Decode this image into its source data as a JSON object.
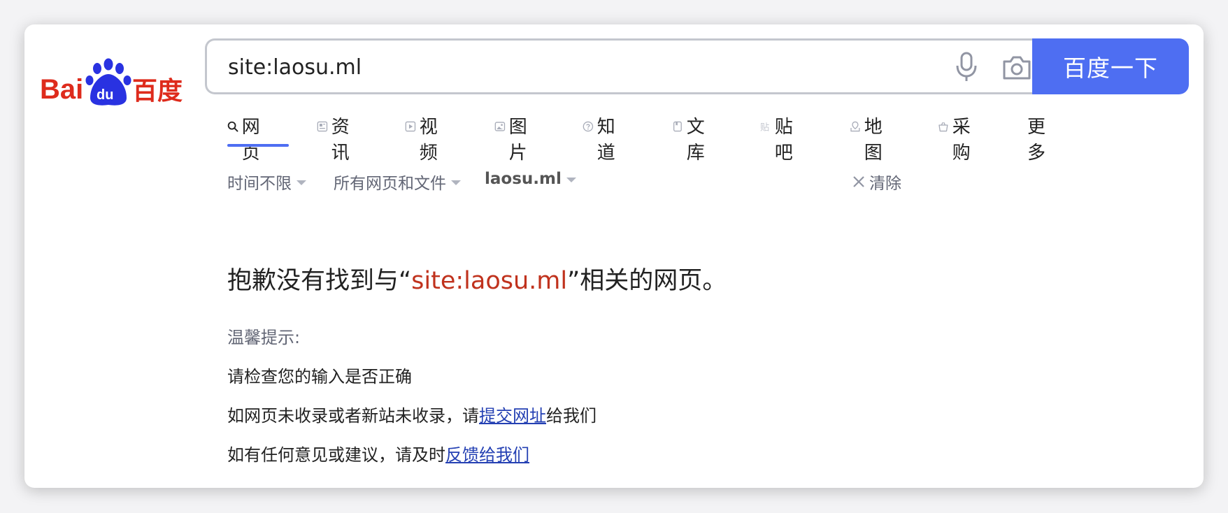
{
  "logo": {
    "brand_text_left": "Bai",
    "brand_text_paw": "du",
    "brand_text_right": "百度"
  },
  "search": {
    "query": "site:laosu.ml",
    "button_label": "百度一下"
  },
  "tabs": [
    {
      "label": "网页",
      "icon": "search-icon",
      "active": true
    },
    {
      "label": "资讯",
      "icon": "news-icon"
    },
    {
      "label": "视频",
      "icon": "video-icon"
    },
    {
      "label": "图片",
      "icon": "image-icon"
    },
    {
      "label": "知道",
      "icon": "question-icon"
    },
    {
      "label": "文库",
      "icon": "document-icon"
    },
    {
      "label": "贴吧",
      "icon": "tieba-icon"
    },
    {
      "label": "地图",
      "icon": "map-icon"
    },
    {
      "label": "采购",
      "icon": "basket-icon"
    },
    {
      "label": "更多"
    }
  ],
  "filters": {
    "time": "时间不限",
    "filetype": "所有网页和文件",
    "site": "laosu.ml",
    "clear": "清除"
  },
  "message": {
    "prefix": "抱歉没有找到与“",
    "query": "site:laosu.ml",
    "suffix": "”相关的网页。"
  },
  "tips": {
    "title": "温馨提示:",
    "line1": "请检查您的输入是否正确",
    "line2_prefix": "如网页未收录或者新站未收录，请",
    "line2_link": "提交网址",
    "line2_suffix": "给我们",
    "line3_prefix": "如有任何意见或建议，请及时",
    "line3_link": "反馈给我们"
  },
  "colors": {
    "accent": "#4e6ef2",
    "logo_red": "#de2b1c",
    "logo_blue": "#2932e1",
    "query_red": "#c0321d",
    "link_blue": "#2440b3"
  }
}
